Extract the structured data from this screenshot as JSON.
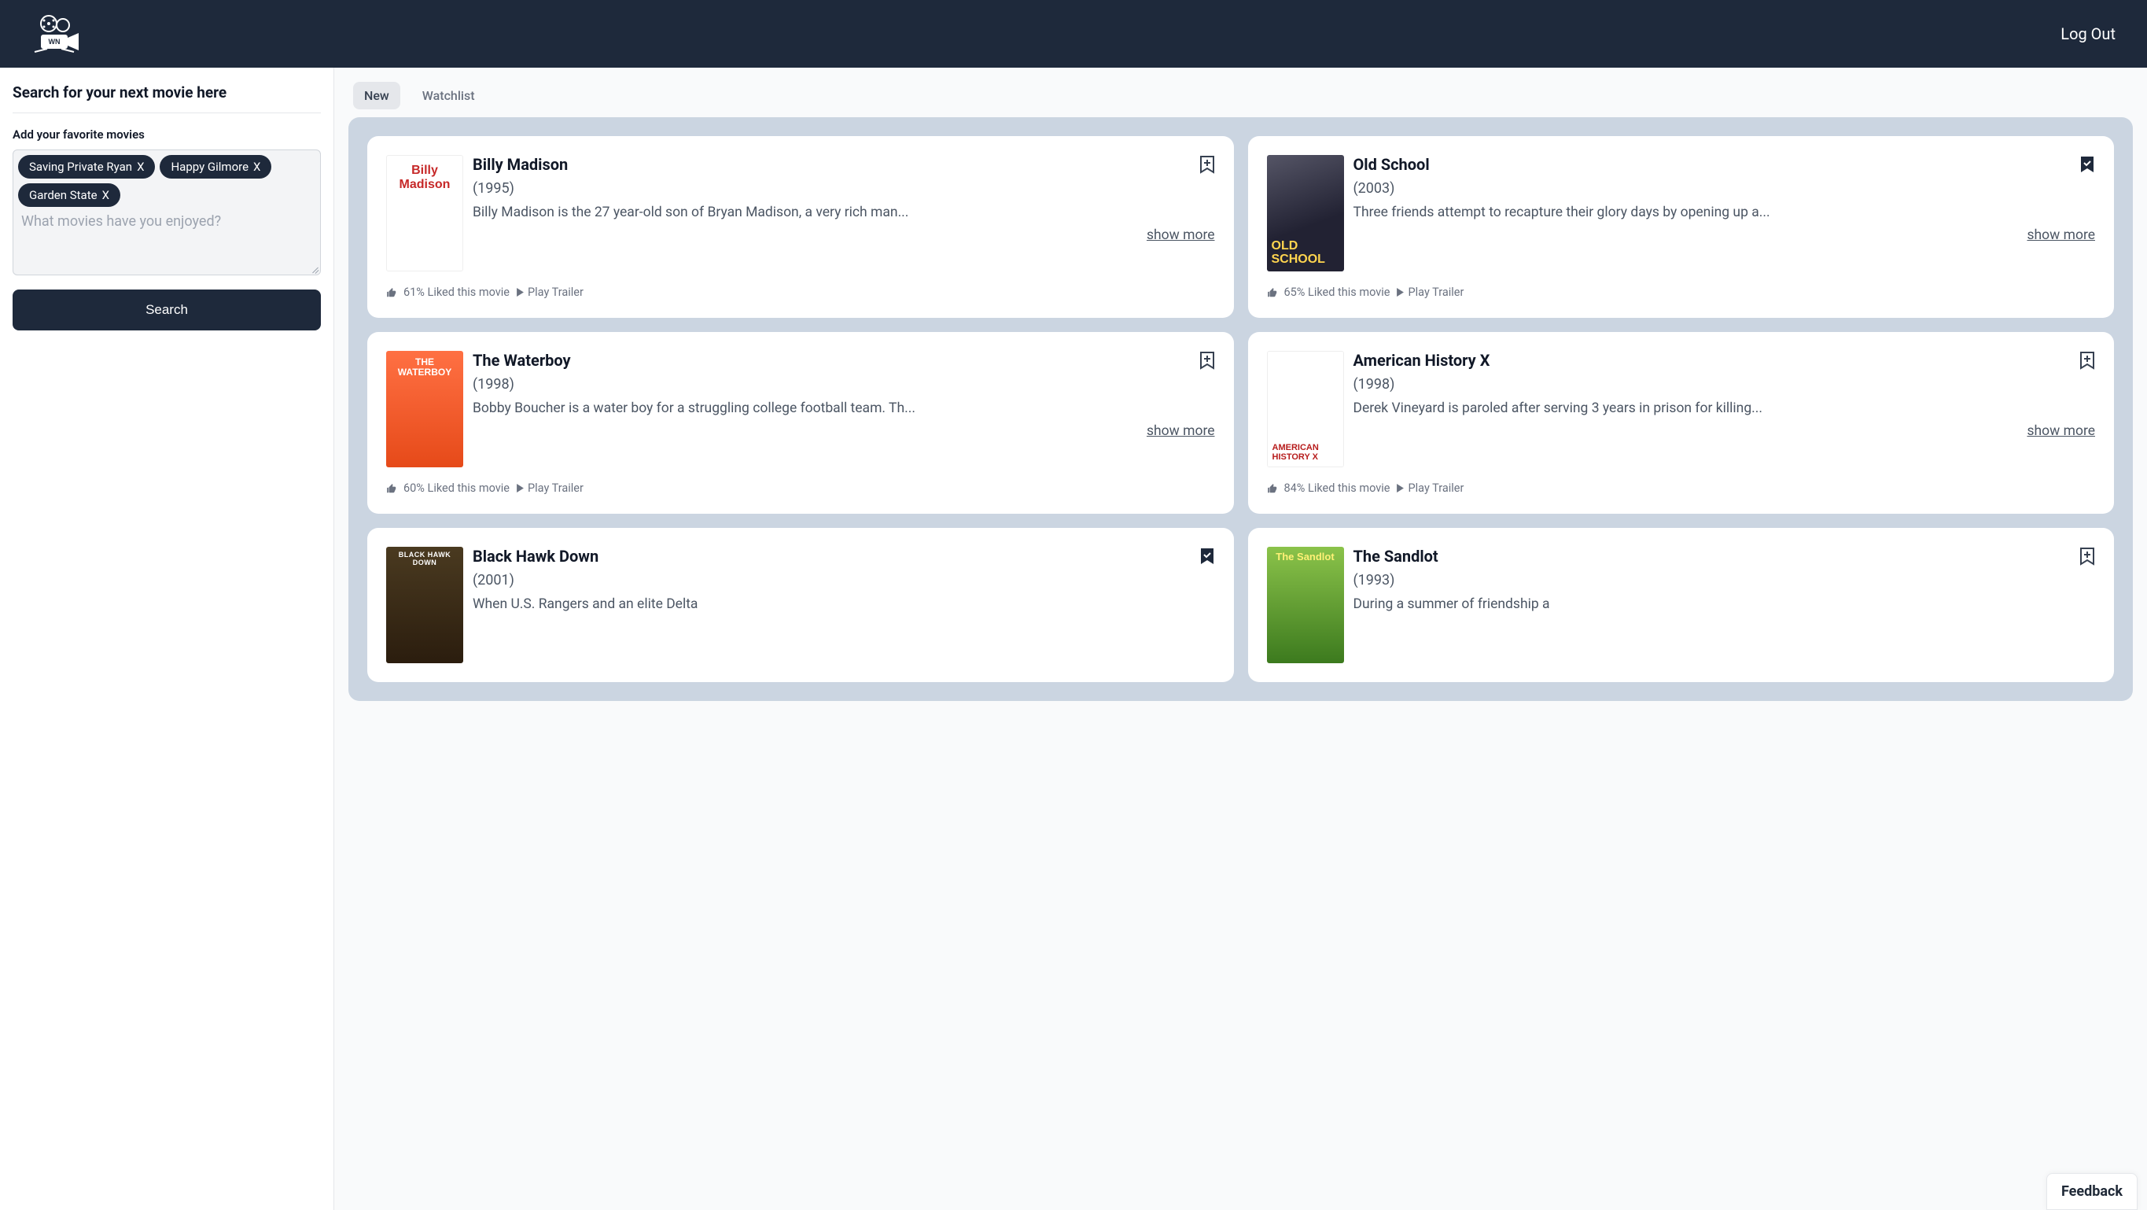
{
  "header": {
    "logout_label": "Log Out",
    "logo_text": "WN"
  },
  "sidebar": {
    "title": "Search for your next movie here",
    "subhead": "Add your favorite movies",
    "placeholder": "What movies have you enjoyed?",
    "search_button": "Search",
    "chips": [
      {
        "label": "Saving Private Ryan"
      },
      {
        "label": "Happy Gilmore"
      },
      {
        "label": "Garden State"
      }
    ]
  },
  "tabs": [
    {
      "label": "New",
      "active": true
    },
    {
      "label": "Watchlist",
      "active": false
    }
  ],
  "common": {
    "show_more": "show more",
    "play_trailer": "Play Trailer",
    "liked_suffix": " Liked this movie",
    "chip_close": "X"
  },
  "movies": [
    {
      "title": "Billy Madison",
      "year": "(1995)",
      "desc": "Billy Madison is the 27 year-old son of Bryan Madison, a very rich man...",
      "liked_pct": "61%",
      "bookmarked": false,
      "poster_class": "billy",
      "poster_label": "Billy Madison"
    },
    {
      "title": "Old School",
      "year": "(2003)",
      "desc": "Three friends attempt to recapture their glory days by opening up a...",
      "liked_pct": "65%",
      "bookmarked": true,
      "poster_class": "oldschool",
      "poster_label": "OLD SCHOOL"
    },
    {
      "title": "The Waterboy",
      "year": "(1998)",
      "desc": "Bobby Boucher is a water boy for a struggling college football team. Th...",
      "liked_pct": "60%",
      "bookmarked": false,
      "poster_class": "waterboy",
      "poster_label": "THE WATERBOY"
    },
    {
      "title": "American History X",
      "year": "(1998)",
      "desc": "Derek Vineyard is paroled after serving 3 years in prison for killing...",
      "liked_pct": "84%",
      "bookmarked": false,
      "poster_class": "ahx",
      "poster_label": "AMERICAN HISTORY X"
    },
    {
      "title": "Black Hawk Down",
      "year": "(2001)",
      "desc": "When U.S. Rangers and an elite Delta",
      "liked_pct": "",
      "bookmarked": true,
      "poster_class": "bhd",
      "poster_label": "BLACK HAWK DOWN"
    },
    {
      "title": "The Sandlot",
      "year": "(1993)",
      "desc": "During a summer of friendship a",
      "liked_pct": "",
      "bookmarked": false,
      "poster_class": "sandlot",
      "poster_label": "The Sandlot"
    }
  ],
  "feedback_label": "Feedback"
}
